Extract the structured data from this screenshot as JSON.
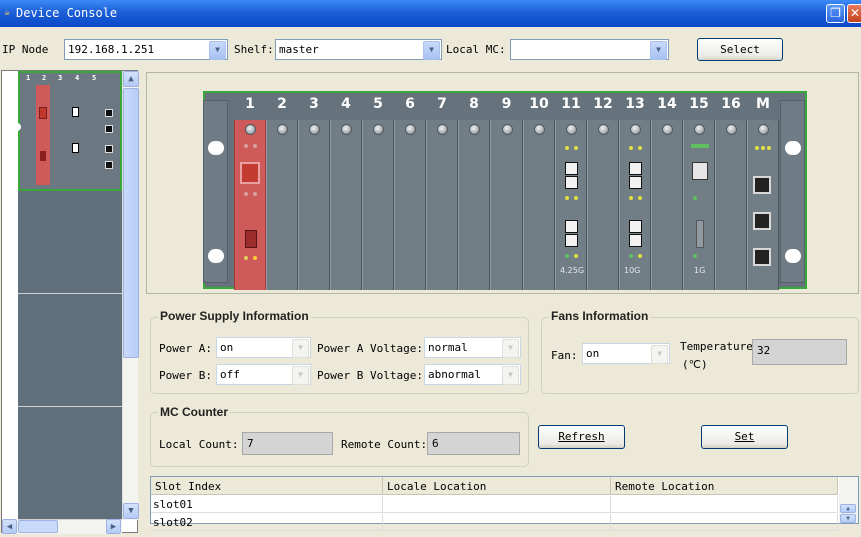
{
  "window": {
    "title": "Device Console"
  },
  "toolbar": {
    "ip_node_label": "IP Node",
    "ip_node_value": "192.168.1.251",
    "shelf_label": "Shelf:",
    "shelf_value": "master",
    "local_mc_label": "Local MC:",
    "local_mc_value": "",
    "select_label": "Select"
  },
  "tree": {
    "slot_numbers": [
      "1",
      "2",
      "3",
      "4",
      "5"
    ]
  },
  "chassis": {
    "slots": [
      {
        "label": "1",
        "type": "red-mc"
      },
      {
        "label": "2",
        "type": "empty"
      },
      {
        "label": "3",
        "type": "empty"
      },
      {
        "label": "4",
        "type": "empty"
      },
      {
        "label": "5",
        "type": "empty"
      },
      {
        "label": "6",
        "type": "empty"
      },
      {
        "label": "7",
        "type": "empty"
      },
      {
        "label": "8",
        "type": "empty"
      },
      {
        "label": "9",
        "type": "empty"
      },
      {
        "label": "10",
        "type": "empty"
      },
      {
        "label": "11",
        "type": "sfp-dual",
        "tag": "4.25G"
      },
      {
        "label": "12",
        "type": "empty"
      },
      {
        "label": "13",
        "type": "sfp-dual",
        "tag": "10G"
      },
      {
        "label": "14",
        "type": "empty"
      },
      {
        "label": "15",
        "type": "rj-1g",
        "tag": "1G"
      },
      {
        "label": "16",
        "type": "empty"
      },
      {
        "label": "M",
        "type": "mgmt"
      }
    ]
  },
  "power": {
    "title": "Power Supply Information",
    "power_a_label": "Power A:",
    "power_a_value": "on",
    "power_b_label": "Power B:",
    "power_b_value": "off",
    "power_a_voltage_label": "Power A Voltage:",
    "power_a_voltage_value": "normal",
    "power_b_voltage_label": "Power B Voltage:",
    "power_b_voltage_value": "abnormal"
  },
  "fans": {
    "title": "Fans Information",
    "fan_label": "Fan:",
    "fan_value": "on",
    "temperature_label": "Temperature",
    "temperature_unit": "(℃)",
    "temperature_value": "32"
  },
  "counter": {
    "title": "MC Counter",
    "local_count_label": "Local Count:",
    "local_count_value": "7",
    "remote_count_label": "Remote Count:",
    "remote_count_value": "6",
    "refresh_label": "Refresh",
    "set_label": "Set"
  },
  "table": {
    "headers": [
      "Slot Index",
      "Locale Location",
      "Remote Location"
    ],
    "rows": [
      [
        "slot01",
        "",
        ""
      ],
      [
        "slot02",
        "",
        ""
      ]
    ]
  }
}
